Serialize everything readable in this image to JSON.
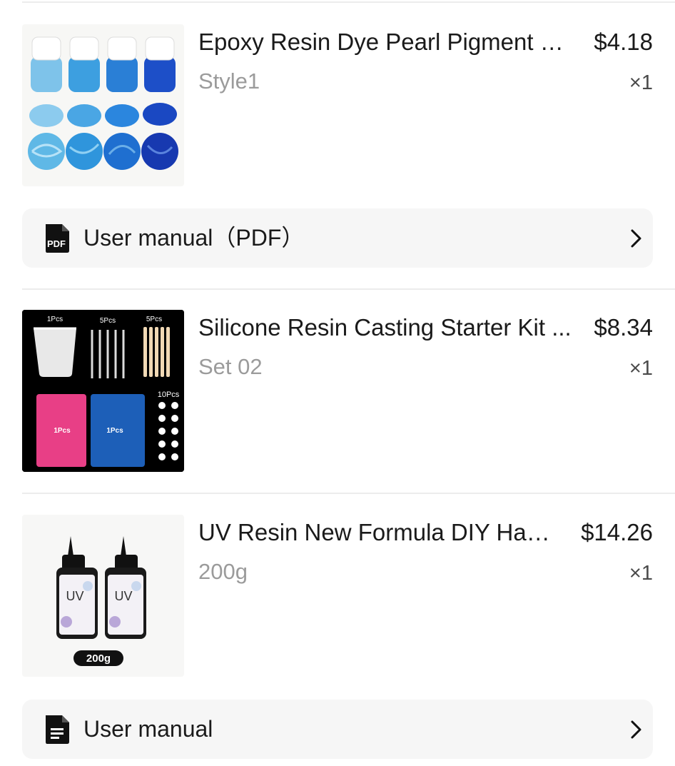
{
  "items": [
    {
      "title": "Epoxy Resin Dye Pearl Pigment S...",
      "variant": "Style1",
      "price": "$4.18",
      "quantity": "×1",
      "image_icon": "blue-pigment-jars-image"
    },
    {
      "title": "Silicone Resin Casting Starter Kit ...",
      "variant": "Set 02",
      "price": "$8.34",
      "quantity": "×1",
      "image_icon": "silicone-kit-image",
      "image_labels": {
        "cup": "1Pcs",
        "pipettes": "5Pcs",
        "sticks": "5Pcs",
        "pink_mat": "1Pcs",
        "blue_mat": "1Pcs",
        "caps": "10Pcs"
      }
    },
    {
      "title": "UV Resin New Formula DIY Han...",
      "variant": "200g",
      "price": "$14.26",
      "quantity": "×1",
      "image_icon": "uv-resin-bottles-image",
      "image_labels": {
        "bottle_brand": "UV",
        "weight_badge": "200g"
      }
    }
  ],
  "manuals": [
    {
      "label": "User manual（PDF）",
      "icon": "pdf-file-icon",
      "badge": "PDF"
    },
    {
      "label": "User manual",
      "icon": "document-icon"
    }
  ],
  "colors": {
    "variant_text": "#9b9b9b",
    "manual_bg": "#f6f6f6",
    "divider": "#ececec"
  }
}
